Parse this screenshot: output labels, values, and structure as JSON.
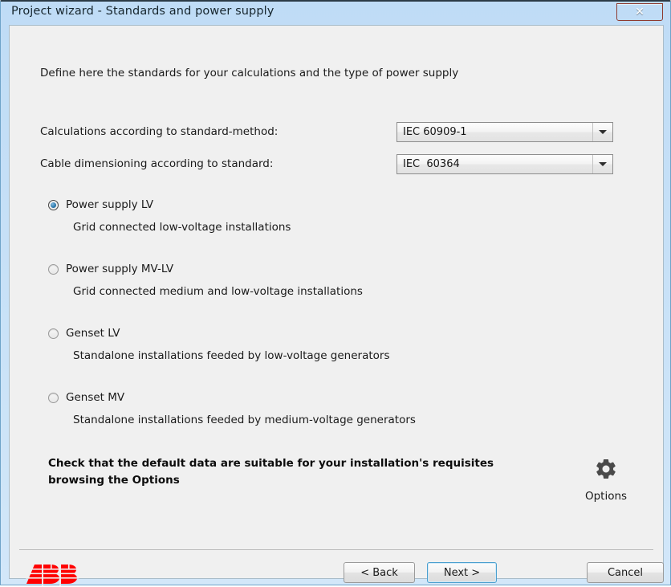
{
  "window": {
    "title": "Project wizard - Standards and power supply",
    "close_icon": "close-icon",
    "close_glyph": "✕"
  },
  "content": {
    "intro": "Define here the standards for your calculations and the type of power supply",
    "fields": [
      {
        "label": "Calculations according to standard-method:",
        "value": "IEC 60909-1",
        "arrow_icon": "chevron-down-icon"
      },
      {
        "label": "Cable dimensioning according to standard:",
        "value": "IEC  60364",
        "arrow_icon": "chevron-down-icon"
      }
    ],
    "power_supply_options": [
      {
        "label": "Power supply LV",
        "description": "Grid connected low-voltage installations",
        "selected": true
      },
      {
        "label": "Power supply MV-LV",
        "description": "Grid connected medium and low-voltage installations",
        "selected": false
      },
      {
        "label": "Genset LV",
        "description": "Standalone installations feeded by low-voltage generators",
        "selected": false
      },
      {
        "label": "Genset MV",
        "description": "Standalone installations feeded by medium-voltage generators",
        "selected": false
      }
    ],
    "note": "Check that the default data are suitable for your installation's requisites browsing the Options",
    "options_button": {
      "label": "Options",
      "icon": "gear-icon"
    }
  },
  "footer": {
    "logo": "ABB",
    "logo_color": "#ff0000",
    "buttons": {
      "back": "< Back",
      "next": "Next >",
      "cancel": "Cancel"
    }
  },
  "colors": {
    "titlebar": "#c6e0f7",
    "client": "#f0f0f0",
    "accent_focus": "#4ca0cf",
    "close_red": "#c9341c",
    "radio_dot": "#2d78ab"
  }
}
